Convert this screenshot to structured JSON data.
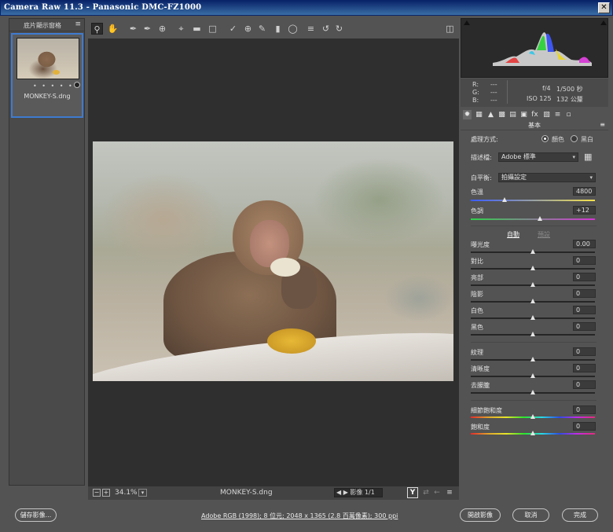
{
  "window": {
    "title": "Camera Raw 11.3  -  Panasonic DMC-FZ1000",
    "close_glyph": "✕"
  },
  "filmstrip": {
    "title": "底片顯示窗格",
    "menu_glyph": "≡",
    "thumb": {
      "filename": "MONKEY-S.dng",
      "rating_dots": "• • • • •"
    }
  },
  "toolbar": {
    "icons": [
      "zoom-tool-icon",
      "hand-tool-icon",
      "white-balance-tool-icon",
      "color-sampler-tool-icon",
      "targeted-adjustment-tool-icon",
      "crop-tool-icon",
      "straighten-tool-icon",
      "transform-tool-icon",
      "spot-removal-tool-icon",
      "red-eye-removal-tool-icon",
      "adjustment-brush-icon",
      "graduated-filter-icon",
      "radial-filter-icon",
      "open-preferences-icon",
      "rotate-ccw-icon",
      "rotate-cw-icon"
    ],
    "fullscreen_icon": "fullscreen-toggle-icon"
  },
  "preview": {
    "zoom": "34.1%",
    "filename": "MONKEY-S.dng",
    "nav_text": "影像 1/1",
    "view_toggle": "Y"
  },
  "readout": {
    "r_label": "R:",
    "g_label": "G:",
    "b_label": "B:",
    "r_val": "---",
    "g_val": "---",
    "b_val": "---",
    "aperture": "f/4",
    "shutter": "1/500 秒",
    "iso": "ISO 125",
    "focal": "132 公釐"
  },
  "panel": {
    "section_title": "基本",
    "menu_glyph": "≡",
    "treatment_label": "處理方式:",
    "treatment_color": "顏色",
    "treatment_bw": "黑白",
    "profile_label": "描述檔:",
    "profile_value": "Adobe 標準",
    "wb_label": "白平衡:",
    "wb_value": "拍攝設定",
    "temp_label": "色溫",
    "temp_value": "4800",
    "tint_label": "色調",
    "tint_value": "+12",
    "auto_label": "自動",
    "default_label": "預設",
    "sliders": [
      {
        "label": "曝光度",
        "value": "0.00"
      },
      {
        "label": "對比",
        "value": "0"
      },
      {
        "label": "亮部",
        "value": "0"
      },
      {
        "label": "陰影",
        "value": "0"
      },
      {
        "label": "白色",
        "value": "0"
      },
      {
        "label": "黑色",
        "value": "0"
      }
    ],
    "presence": [
      {
        "label": "紋理",
        "value": "0"
      },
      {
        "label": "清晰度",
        "value": "0"
      },
      {
        "label": "去朦朧",
        "value": "0"
      }
    ],
    "vibrance_label": "細節飽和度",
    "vibrance_value": "0",
    "saturation_label": "飽和度",
    "saturation_value": "0"
  },
  "bottom": {
    "save_label": "儲存影像...",
    "info_link": "Adobe RGB (1998); 8 位元; 2048 x 1365 (2.8 百萬像素); 300 ppi",
    "open_label": "開啟影像",
    "cancel_label": "取消",
    "done_label": "完成"
  }
}
